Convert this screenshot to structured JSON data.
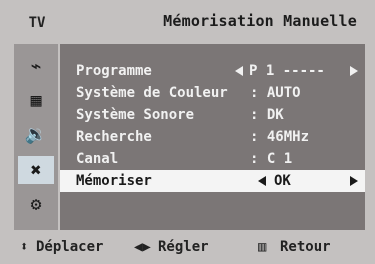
{
  "header": {
    "tab_label": "TV",
    "title": "Mémorisation Manuelle"
  },
  "sidebar": {
    "icons": [
      "tv-antenna-icon",
      "picture-icon",
      "speaker-icon",
      "satellite-icon",
      "settings-icon"
    ]
  },
  "menu": {
    "rows": [
      {
        "label": "Programme",
        "value": "P 1   -----"
      },
      {
        "label": "Système de Couleur",
        "value": ": AUTO"
      },
      {
        "label": "Système Sonore",
        "value": ":  DK"
      },
      {
        "label": "Recherche",
        "value": ":   46MHz"
      },
      {
        "label": "Canal",
        "value": ":  C 1"
      },
      {
        "label": "Mémoriser",
        "value": "OK"
      }
    ]
  },
  "footer": {
    "move": "Déplacer",
    "adjust": "Régler",
    "back": "Retour"
  }
}
